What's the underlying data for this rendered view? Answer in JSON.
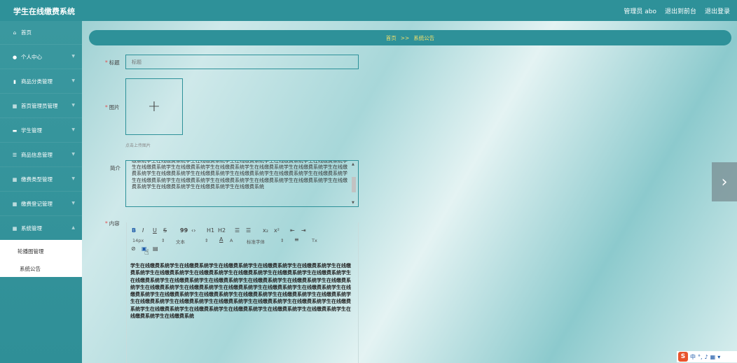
{
  "header": {
    "app_title": "学生在线缴费系统",
    "admin_label": "管理员 abo",
    "exit_to_front": "退出到前台",
    "logout": "退出登录"
  },
  "sidebar": {
    "items": [
      {
        "label": "首页",
        "icon": "home-icon"
      },
      {
        "label": "个人中心",
        "icon": "user-icon"
      },
      {
        "label": "商品分类管理",
        "icon": "bar-chart-icon"
      },
      {
        "label": "首页管理员管理",
        "icon": "grid-icon"
      },
      {
        "label": "学生管理",
        "icon": "card-icon"
      },
      {
        "label": "商品信息管理",
        "icon": "list-icon"
      },
      {
        "label": "缴费类型管理",
        "icon": "grid-icon"
      },
      {
        "label": "缴费登记管理",
        "icon": "grid-icon"
      },
      {
        "label": "系统管理",
        "icon": "grid-icon"
      }
    ],
    "submenu": [
      {
        "label": "轮播图管理"
      },
      {
        "label": "系统公告"
      }
    ]
  },
  "breadcrumb": {
    "home": "首页",
    "separator": ">>",
    "current": "系统公告"
  },
  "form": {
    "title_label": "标题",
    "title_placeholder": "标题",
    "image_label": "图片",
    "upload_hint": "点击上传图片",
    "intro_label": "简介",
    "intro_text": "缴系统学生在线缴费系统学生在线缴费系统学生在线缴费系统学生在线缴费系统学生在线缴费系统学生在线缴费系统学生在线缴费系统学生在线缴费系统学生在线缴费系统学生在线缴费系统学生在线缴费系统学生在线缴费系统学生在线缴费系统学生在线缴费系统学生在线缴费系统学生在线缴费系统学生在线缴费系统学生在线缴费系统学生在线缴费系统学生在线缴费系统学生在线缴费系统学生在线缴费系统学生在线缴费系统学生在线缴费系统学生在线缴费系统",
    "content_label": "内容",
    "content_text": "学生在线缴费系统学生在线缴费系统学生在线缴费系统学生在线缴费系统学生在线缴费系统学生在线缴费系统学生在线缴费系统学生在线缴费系统学生在线缴费系统学生在线缴费系统学生在线缴费系统学生在线缴费系统学生在线缴费系统学生在线缴费系统学生在线缴费系统学生在线缴费系统学生在线缴费系统学生在线缴费系统学生在线缴费系统学生在线缴费系统学生在线缴费系统学生在线缴费系统学生在线缴费系统学生在线缴费系统学生在线缴费系统学生在线缴费系统学生在线缴费系统学生在线缴费系统学生在线缴费系统学生在线缴费系统学生在线缴费系统学生在线缴费系统学生在线缴费系统学生在线缴费系统学生在线缴费系统学生在线缴费系统学生在线缴费系统学生在线缴费系统学生在线缴费系统学生在线缴费系统学生在线缴费系统"
  },
  "toolbar": {
    "bold": "B",
    "italic": "I",
    "underline": "U",
    "strike": "S",
    "quote": "99",
    "code": "‹›",
    "h1": "H1",
    "h2": "H2",
    "ordered_list": "☰",
    "bullet_list": "☰",
    "subscript": "x₂",
    "superscript": "x²",
    "indent_left": "⇤",
    "indent_right": "⇥",
    "font_size": "14px",
    "paragraph": "文本",
    "font_color": "A",
    "background": "A",
    "font_family": "标准字体",
    "align": "≡",
    "clear": "Tx"
  },
  "colors": {
    "primary": "#2e9199",
    "breadcrumb_text": "#f2e06b",
    "required": "#e05050"
  },
  "ime": {
    "brand": "S",
    "lang": "中"
  }
}
